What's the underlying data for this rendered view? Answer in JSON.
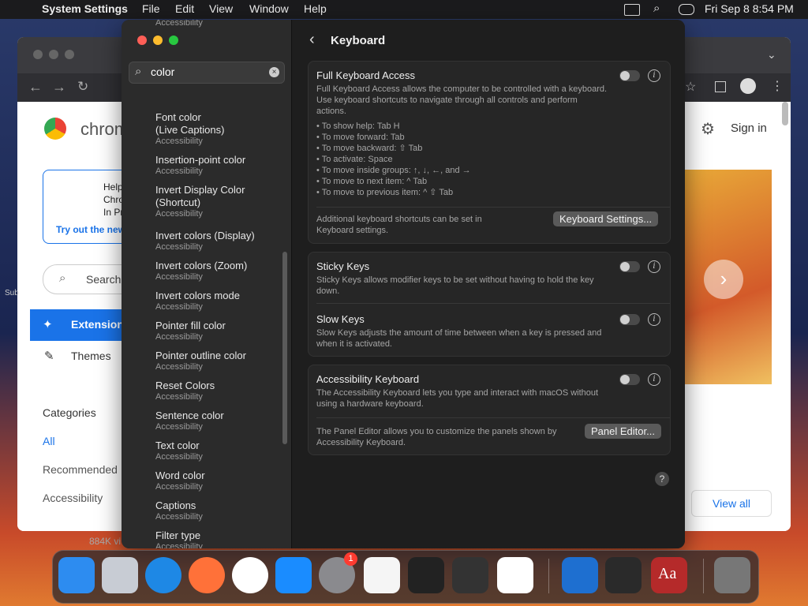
{
  "menubar": {
    "app_name": "System Settings",
    "menus": [
      "File",
      "Edit",
      "View",
      "Window",
      "Help"
    ],
    "datetime": "Fri Sep 8  8:54 PM"
  },
  "chrome_bg": {
    "brand": "chrom",
    "sign_in": "Sign in",
    "promo_lines": [
      "Help",
      "Chro",
      "In Pr"
    ],
    "promo_link": "Try out the new",
    "search": "Search",
    "nav_extensions": "Extension",
    "nav_themes": "Themes",
    "categories_title": "Categories",
    "categories": [
      "All",
      "Recommended",
      "Accessibility"
    ],
    "view_all": "View all",
    "status_count": "884K vi",
    "side_sub": "Sub"
  },
  "sidebar": {
    "search_value": "color",
    "results": [
      {
        "title": "",
        "sub": "Accessibility"
      },
      {
        "title": "Font color\n(Live Captions)",
        "sub": "Accessibility"
      },
      {
        "title": "Insertion-point color",
        "sub": "Accessibility"
      },
      {
        "title": "Invert Display Color\n(Shortcut)",
        "sub": "Accessibility"
      },
      {
        "title": "Invert colors (Display)",
        "sub": "Accessibility"
      },
      {
        "title": "Invert colors (Zoom)",
        "sub": "Accessibility"
      },
      {
        "title": "Invert colors mode",
        "sub": "Accessibility"
      },
      {
        "title": "Pointer fill color",
        "sub": "Accessibility"
      },
      {
        "title": "Pointer outline color",
        "sub": "Accessibility"
      },
      {
        "title": "Reset Colors",
        "sub": "Accessibility"
      },
      {
        "title": "Sentence color",
        "sub": "Accessibility"
      },
      {
        "title": "Text color",
        "sub": "Accessibility"
      },
      {
        "title": "Word color",
        "sub": "Accessibility"
      },
      {
        "title": "Captions",
        "sub": "Accessibility"
      },
      {
        "title": "Filter type",
        "sub": "Accessibility"
      }
    ]
  },
  "main": {
    "title": "Keyboard",
    "fka": {
      "title": "Full Keyboard Access",
      "desc": "Full Keyboard Access allows the computer to be controlled with a keyboard. Use keyboard shortcuts to navigate through all controls and perform actions.",
      "bullets": [
        "• To show help: Tab H",
        "• To move forward: Tab",
        "• To move backward: ⇧ Tab",
        "• To activate: Space",
        "• To move inside groups: ↑, ↓, ←, and →",
        "• To move to next item: ^ Tab",
        "• To move to previous item: ^ ⇧ Tab"
      ],
      "footer": "Additional keyboard shortcuts can be set in Keyboard settings.",
      "button": "Keyboard Settings..."
    },
    "sticky": {
      "title": "Sticky Keys",
      "desc": "Sticky Keys allows modifier keys to be set without having to hold the key down."
    },
    "slow": {
      "title": "Slow Keys",
      "desc": "Slow Keys adjusts the amount of time between when a key is pressed and when it is activated."
    },
    "akb": {
      "title": "Accessibility Keyboard",
      "desc": "The Accessibility Keyboard lets you type and interact with macOS without using a hardware keyboard.",
      "footer": "The Panel Editor allows you to customize the panels shown by Accessibility Keyboard.",
      "button": "Panel Editor..."
    },
    "help": "?"
  },
  "dock": {
    "apps": [
      "finder",
      "launchpad",
      "safari",
      "firefox",
      "chrome",
      "app-store",
      "system-settings",
      "textedit",
      "terminal",
      "garageband",
      "vscode",
      "keynote",
      "activity-monitor",
      "dictionary",
      "trash"
    ],
    "badge": "1",
    "dictionary_label": "Aa"
  },
  "colors": {
    "accent": "#0a84ff",
    "close": "#ff5f57",
    "min": "#febc2e",
    "max": "#28c840"
  }
}
